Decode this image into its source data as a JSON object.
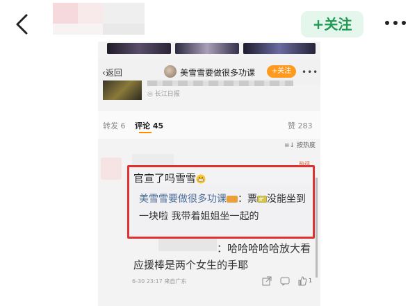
{
  "app": {
    "follow_label": "+关注"
  },
  "inner": {
    "back_label": "返回",
    "account_title": "美雪雪要做很多功课",
    "follow_label": "+关注",
    "source": "长江日报",
    "stats": {
      "shares": "转发 6",
      "comments": "评论 45",
      "likes": "赞 283"
    },
    "sort_label": "按热度",
    "hot_tag": "热评",
    "comment": {
      "text": "官宣了吗雪雪"
    },
    "reply": {
      "author": "美雪雪要做很多功课",
      "colon": "：",
      "text_part1": "票",
      "text_part2": "没能坐到一块啦 我带着姐姐坐一起的"
    },
    "reply2": {
      "text": "：哈哈哈哈哈放大看应援棒是两个女生的手耶"
    },
    "meta": {
      "time": "6-30 23:17",
      "location": "来自广东",
      "like_count": "1"
    }
  },
  "colors": {
    "follow_green": "#1f9a53",
    "highlight_red": "#e03131",
    "reply_name_blue": "#4a6d98",
    "inner_follow_orange": "#ff9a1e"
  }
}
